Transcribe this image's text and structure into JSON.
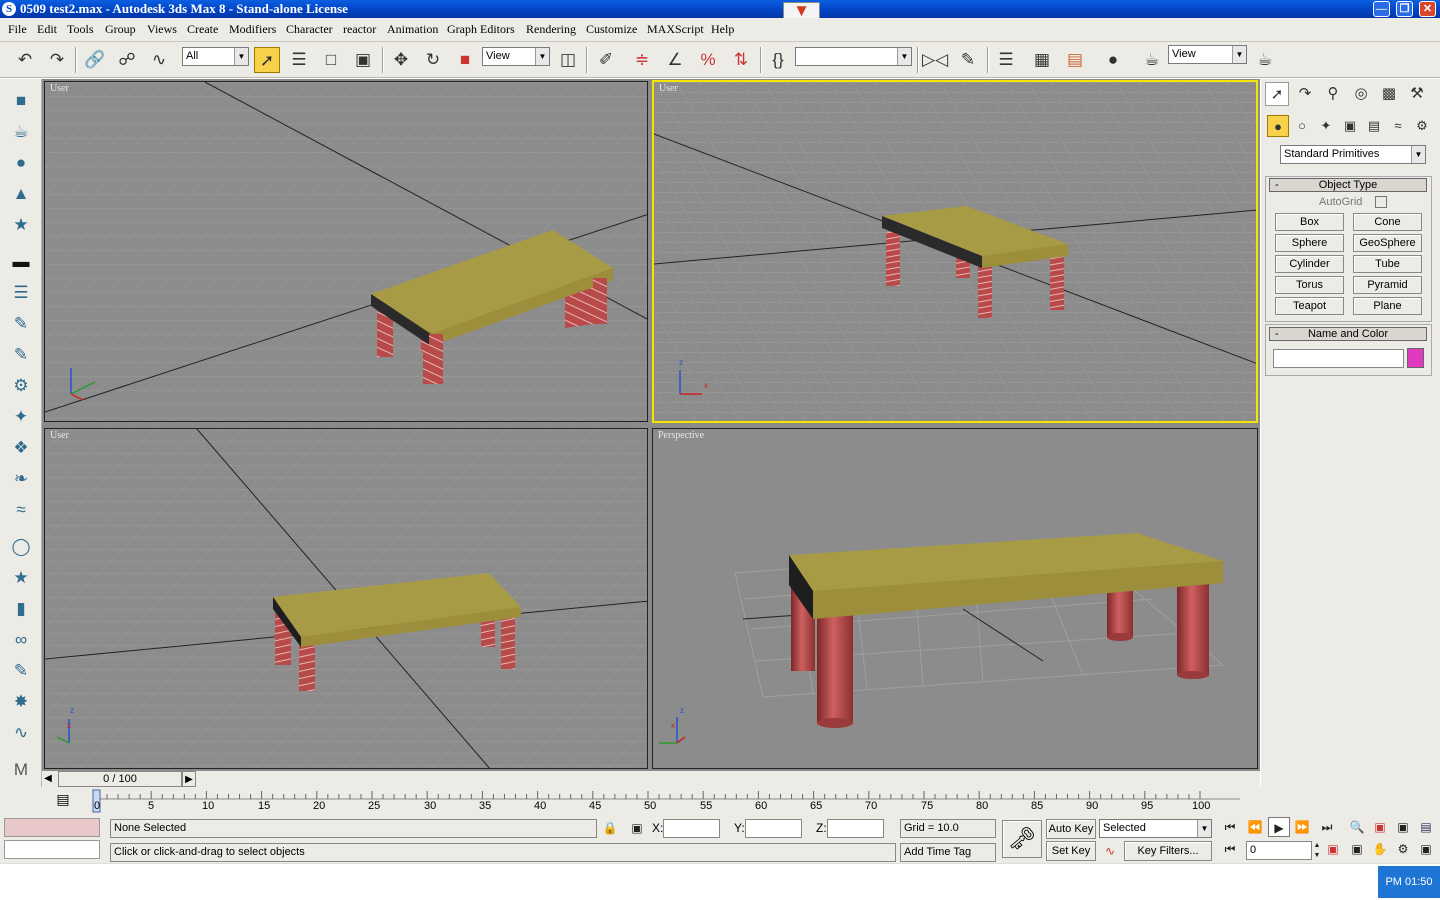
{
  "window": {
    "title": "0509 test2.max - Autodesk 3ds Max 8 - Stand-alone License",
    "app_icon": "3ds-max-icon",
    "buttons": [
      "minimize-icon",
      "restore-icon",
      "close-icon"
    ]
  },
  "menu": {
    "items": [
      "File",
      "Edit",
      "Tools",
      "Group",
      "Views",
      "Create",
      "Modifiers",
      "Character",
      "reactor",
      "Animation",
      "Graph Editors",
      "Rendering",
      "Customize",
      "MAXScript",
      "Help"
    ]
  },
  "toolbar": {
    "selection_filter": "All",
    "ref_coord": "View",
    "named_selection": "",
    "view_combo": "View"
  },
  "viewports": [
    {
      "label": "User",
      "active": false
    },
    {
      "label": "User",
      "active": true
    },
    {
      "label": "User",
      "active": false
    },
    {
      "label": "Perspective",
      "active": false
    }
  ],
  "axis_labels": {
    "x": "x",
    "z": "z"
  },
  "colors": {
    "selection_highlight": "#f4e400",
    "table_top": "#a89b45",
    "table_legs": "#b84a4a",
    "object_color_swatch": "#e03ac0",
    "viewport_bg": "#8c8c8c"
  },
  "command_panel": {
    "category": "Standard Primitives",
    "object_type_title": "Object Type",
    "autogrid_label": "AutoGrid",
    "primitives": [
      "Box",
      "Cone",
      "Sphere",
      "GeoSphere",
      "Cylinder",
      "Tube",
      "Torus",
      "Pyramid",
      "Teapot",
      "Plane"
    ],
    "name_color_title": "Name and Color",
    "name_value": ""
  },
  "timeline": {
    "frame_display": "0 / 100",
    "ticks": [
      "0",
      "5",
      "10",
      "15",
      "20",
      "25",
      "30",
      "35",
      "40",
      "45",
      "50",
      "55",
      "60",
      "65",
      "70",
      "75",
      "80",
      "85",
      "90",
      "95",
      "100"
    ]
  },
  "status": {
    "selection": "None Selected",
    "prompt": "Click or click-and-drag to select objects",
    "x_label": "X:",
    "y_label": "Y:",
    "z_label": "Z:",
    "grid": "Grid = 10.0",
    "add_time_tag": "Add Time Tag",
    "auto_key": "Auto Key",
    "set_key": "Set Key",
    "key_mode": "Selected",
    "key_filters": "Key Filters...",
    "current_frame": "0"
  },
  "taskbar": {
    "clock": "PM 01:50"
  }
}
